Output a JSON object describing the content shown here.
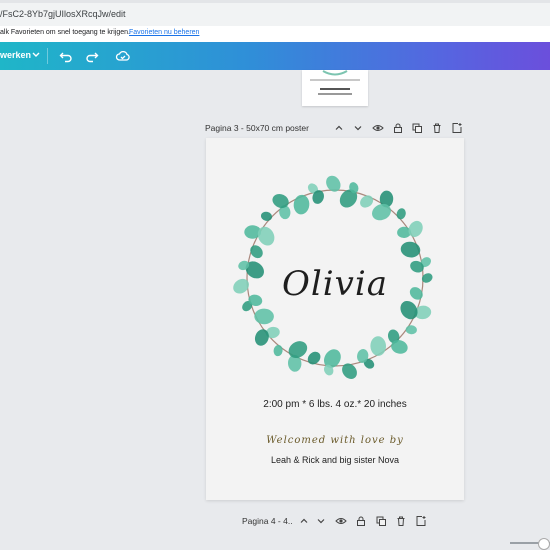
{
  "browser": {
    "url": "/FsC2-8Yb7gjUIlosXRcqJw/edit",
    "favorites_message": "alk Favorieten om snel toegang te krijgen.",
    "favorites_link": "Favorieten nu beheren"
  },
  "toolbar": {
    "edit_label": "werken",
    "chevron_icon": "chevron-down-icon",
    "undo_icon": "undo-icon",
    "redo_icon": "redo-icon",
    "save_icon": "cloud-check-icon"
  },
  "page3": {
    "title": "Pagina 3 - 50x70 cm poster"
  },
  "poster": {
    "name": "Olivia",
    "birth_details": "2:00 pm * 6 lbs. 4 oz.* 20 inches",
    "welcome": "Welcomed with love by",
    "family": "Leah & Rick and big sister Nova",
    "leaf_color": "#3aa88c",
    "stem_color": "#8a5a4a"
  },
  "page4": {
    "title": "Pagina 4 - 4.."
  },
  "colors": {
    "toolbar_start": "#1fb6c8",
    "toolbar_end": "#6b4fdc",
    "link": "#1a73e8"
  }
}
